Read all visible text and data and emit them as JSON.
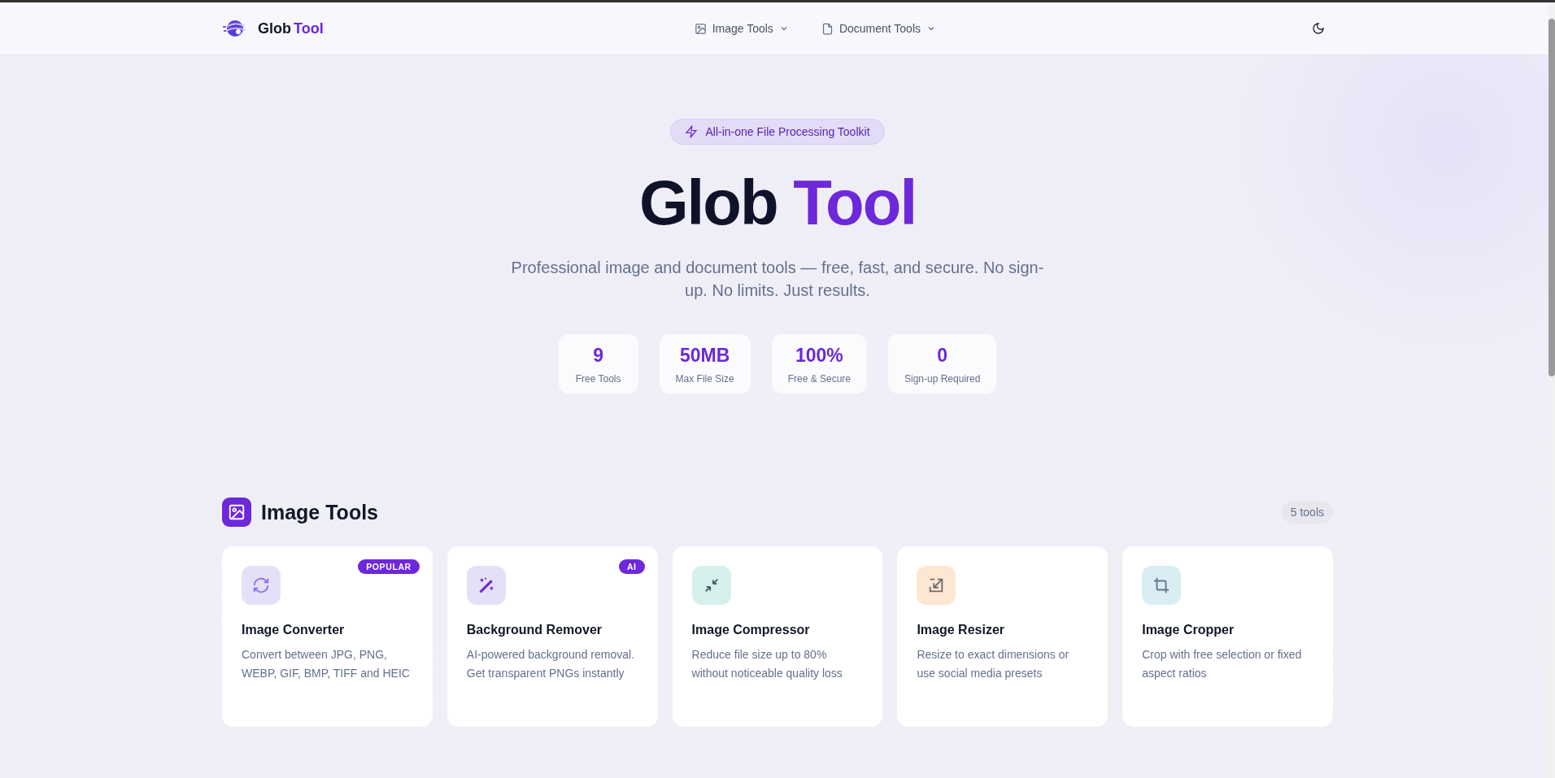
{
  "header": {
    "brand": {
      "first": "Glob",
      "second": "Tool"
    },
    "nav": [
      {
        "label": "Image Tools",
        "kind": "image"
      },
      {
        "label": "Document Tools",
        "kind": "file"
      }
    ]
  },
  "hero": {
    "badge": "All-in-one File Processing Toolkit",
    "title": {
      "first": "Glob",
      "second": "Tool"
    },
    "subtitle": "Professional image and document tools — free, fast, and secure. No sign-up. No limits. Just results.",
    "stats": [
      {
        "value": "9",
        "label": "Free Tools"
      },
      {
        "value": "50MB",
        "label": "Max File Size"
      },
      {
        "value": "100%",
        "label": "Free & Secure"
      },
      {
        "value": "0",
        "label": "Sign-up Required"
      }
    ]
  },
  "section": {
    "title": "Image Tools",
    "count": "5 tools",
    "tools": [
      {
        "name": "Image Converter",
        "description": "Convert between JPG, PNG, WEBP, GIF, BMP, TIFF and HEIC",
        "kind": "refresh",
        "color": "#e4e0f8",
        "badge": "POPULAR"
      },
      {
        "name": "Background Remover",
        "description": "AI-powered background removal. Get transparent PNGs instantly",
        "kind": "wand",
        "color": "#e4e0f8",
        "badge": "AI"
      },
      {
        "name": "Image Compressor",
        "description": "Reduce file size up to 80% without noticeable quality loss",
        "kind": "compress",
        "color": "#d6f0ee"
      },
      {
        "name": "Image Resizer",
        "description": "Resize to exact dimensions or use social media presets",
        "kind": "resize",
        "color": "#fde6d2"
      },
      {
        "name": "Image Cropper",
        "description": "Crop with free selection or fixed aspect ratios",
        "kind": "crop",
        "color": "#d8eef2"
      }
    ]
  }
}
